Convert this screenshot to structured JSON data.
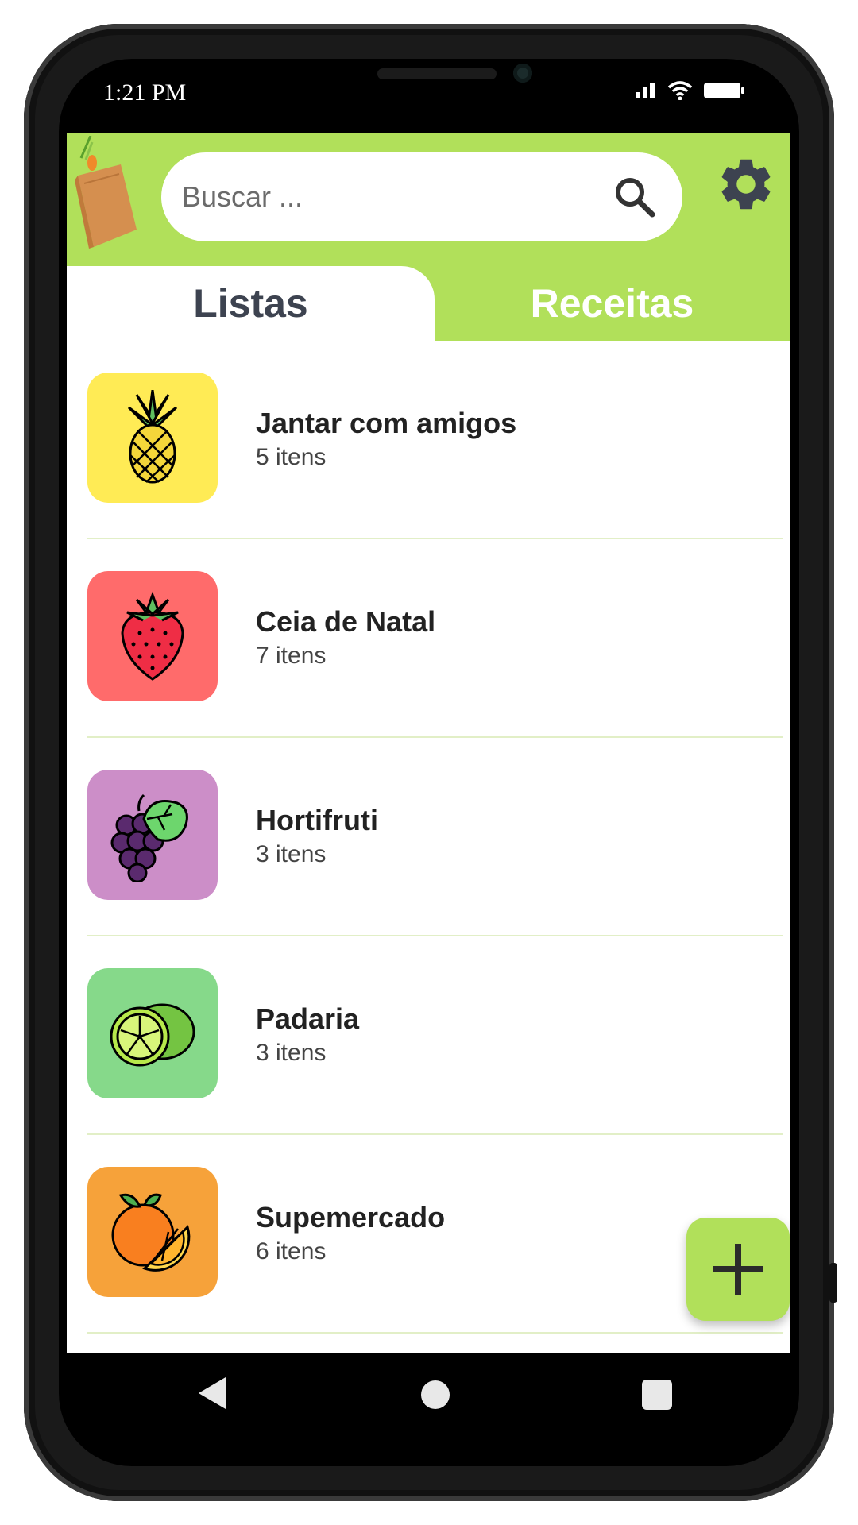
{
  "status_bar": {
    "time": "1:21 PM"
  },
  "search": {
    "placeholder": "Buscar ..."
  },
  "tabs": [
    {
      "label": "Listas",
      "active": true
    },
    {
      "label": "Receitas",
      "active": false
    }
  ],
  "lists": [
    {
      "title": "Jantar com amigos",
      "count": "5 itens",
      "icon": "pineapple-icon",
      "color": "#ffeb55"
    },
    {
      "title": "Ceia de Natal",
      "count": "7 itens",
      "icon": "strawberry-icon",
      "color": "#ff6b6b"
    },
    {
      "title": "Hortifruti",
      "count": "3 itens",
      "icon": "grapes-icon",
      "color": "#cc8ec8"
    },
    {
      "title": "Padaria",
      "count": "3 itens",
      "icon": "lime-icon",
      "color": "#86d98a"
    },
    {
      "title": "Supemercado",
      "count": "6 itens",
      "icon": "orange-icon",
      "color": "#f6a23a"
    }
  ],
  "theme": {
    "accent": "#b1e05a",
    "tab_text": "#3d4350",
    "icon_dark": "#3d4350"
  }
}
